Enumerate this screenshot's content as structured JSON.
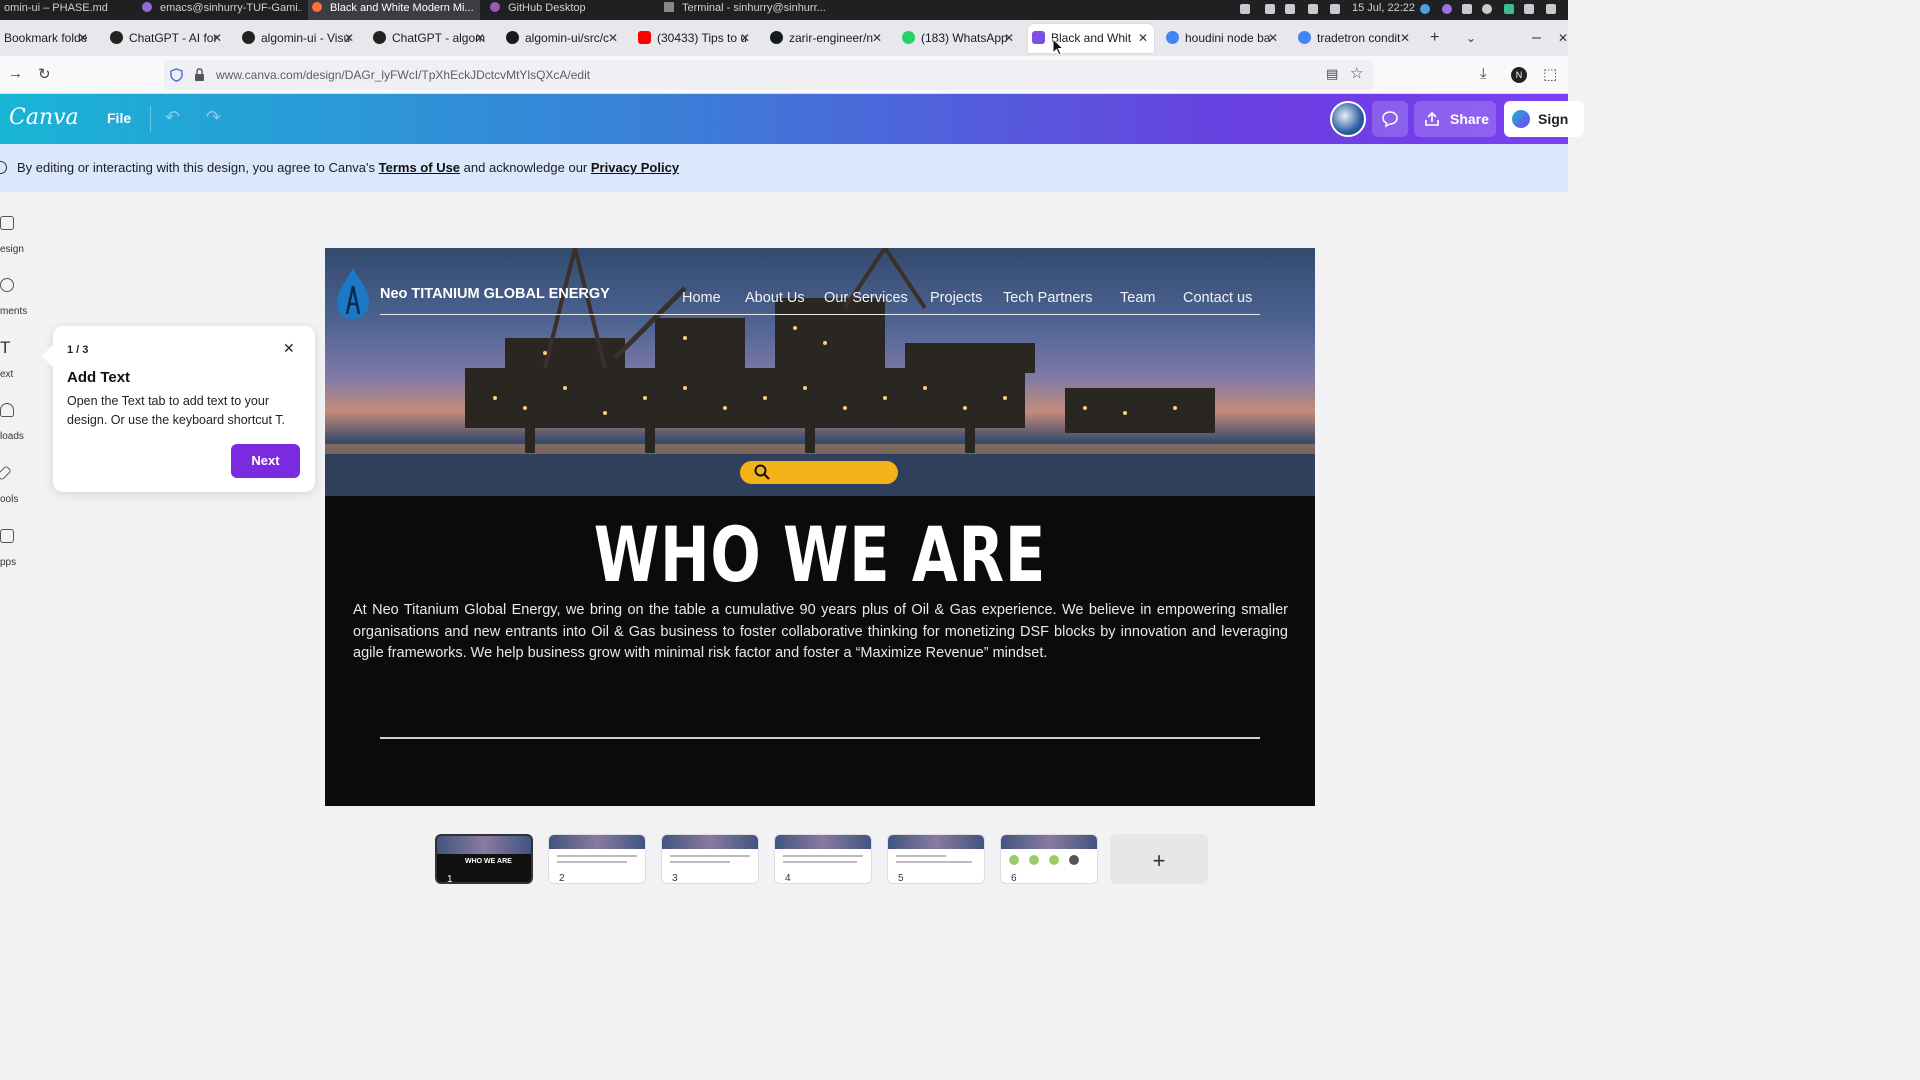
{
  "os_bar": {
    "tabs": [
      {
        "label": "omin-ui – PHASE.md",
        "icon": "editor-icon"
      },
      {
        "label": "emacs@sinhurry-TUF-Gami...",
        "icon": "emacs-icon"
      },
      {
        "label": "Black and White Modern Mi...",
        "icon": "firefox-icon"
      },
      {
        "label": "GitHub Desktop",
        "icon": "github-desktop-icon"
      },
      {
        "label": "Terminal - sinhurry@sinhurr...",
        "icon": "terminal-icon"
      }
    ],
    "clock": "15 Jul, 22:22"
  },
  "browser_tabs": [
    {
      "label": "Bookmark folde",
      "active": false
    },
    {
      "label": "ChatGPT - AI for",
      "active": false
    },
    {
      "label": "algomin-ui - Visu",
      "active": false
    },
    {
      "label": "ChatGPT - algom",
      "active": false
    },
    {
      "label": "algomin-ui/src/c",
      "active": false
    },
    {
      "label": "(30433) Tips to u",
      "active": false
    },
    {
      "label": "zarir-engineer/n",
      "active": false
    },
    {
      "label": "(183) WhatsApp",
      "active": false
    },
    {
      "label": "Black and Whit",
      "active": true
    },
    {
      "label": "houdini node ba",
      "active": false
    },
    {
      "label": "tradetron condit",
      "active": false
    }
  ],
  "url": "www.canva.com/design/DAGr_lyFWcI/TpXhEckJDctcvMtYlsQXcA/edit",
  "canva": {
    "logo": "Canva",
    "file_label": "File",
    "share_label": "Share",
    "sign_label": "Sign"
  },
  "notice": {
    "prefix": "By editing or interacting with this design, you agree to Canva's",
    "terms": "Terms of Use",
    "middle": "and acknowledge our",
    "privacy": "Privacy Policy"
  },
  "rail": [
    {
      "label": "esign",
      "icon": "design-icon"
    },
    {
      "label": "ments",
      "icon": "elements-icon"
    },
    {
      "label": "ext",
      "icon": "text-icon"
    },
    {
      "label": "loads",
      "icon": "uploads-icon"
    },
    {
      "label": "ools",
      "icon": "draw-icon"
    },
    {
      "label": "pps",
      "icon": "apps-icon"
    }
  ],
  "popup": {
    "step": "1 / 3",
    "title": "Add Text",
    "body": "Open the Text tab to add text to your design. Or use the keyboard shortcut T.",
    "next": "Next"
  },
  "design": {
    "brand": "Neo TITANIUM GLOBAL ENERGY",
    "nav": [
      "Home",
      "About Us",
      "Our Services",
      "Projects",
      "Tech Partners",
      "Team",
      "Contact us"
    ],
    "heading": "WHO WE ARE",
    "body": "At Neo Titanium Global Energy, we bring on the table a cumulative 90 years plus of Oil & Gas experience. We believe in empowering smaller organisations and new entrants into Oil & Gas business to foster collaborative thinking for monetizing DSF blocks by innovation and leveraging agile frameworks. We help business grow with minimal risk factor and foster a “Maximize Revenue” mindset.",
    "accent_color": "#f3b21a"
  },
  "pages": [
    "1",
    "2",
    "3",
    "4",
    "5",
    "6"
  ],
  "add_page": "+"
}
